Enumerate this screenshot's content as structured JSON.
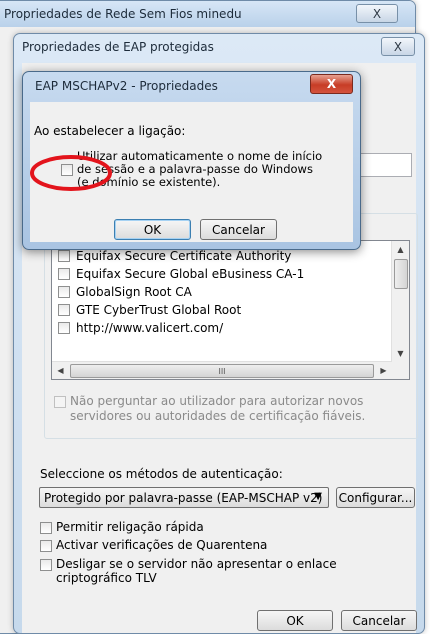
{
  "outer_window": {
    "title": "Propriedades de Rede Sem Fios minedu",
    "close": "X"
  },
  "eap_window": {
    "title": "Propriedades de EAP protegidas",
    "close": "X",
    "certificates": [
      "Equifax Secure Certificate Authority",
      "Equifax Secure Global eBusiness CA-1",
      "GlobalSign Root CA",
      "GTE CyberTrust Global Root",
      "http://www.valicert.com/"
    ],
    "scroll_thumb": "III",
    "no_prompt_label": "Não perguntar ao utilizador para autorizar novos servidores ou autoridades de certificação fiáveis.",
    "auth_method_label": "Seleccione os métodos de autenticação:",
    "auth_method_value": "Protegido por palavra-passe (EAP-MSCHAP v2)",
    "configure_button": "Configurar...",
    "fast_reconnect": "Permitir religação rápida",
    "quarantine": "Activar verificações de Quarentena",
    "disconnect_label": "Desligar se o servidor não apresentar o enlace criptográfico TLV",
    "ok_button": "OK",
    "cancel_button": "Cancelar"
  },
  "mschap_dialog": {
    "title": "EAP MSCHAPv2 - Propriedades",
    "close": "X",
    "connect_label": "Ao estabelecer a ligação:",
    "auto_logon_label": "Utilizar automaticamente o nome de início de sessão e a palavra-passe do Windows (e domínio se existente).",
    "auto_logon_checked": false,
    "ok_button": "OK",
    "cancel_button": "Cancelar"
  },
  "highlight_color": "#e3141c"
}
